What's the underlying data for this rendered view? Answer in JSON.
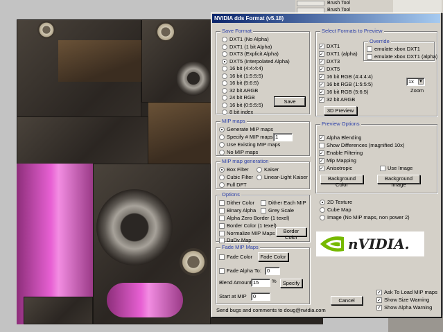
{
  "photoshop": {
    "layers": [
      "Brush Tool",
      "Brush Tool"
    ]
  },
  "dialog": {
    "title": "NVIDIA dds Format (v5.18)",
    "save_format": {
      "title": "Save Format",
      "options": [
        "DXT1 (No Alpha)",
        "DXT1 (1 bit Alpha)",
        "DXT3 (Explicit Alpha)",
        "DXT5 (Interpolated Alpha)",
        "4:4:4:4",
        "16 bit (1:5:5:5)",
        "16 bit (5:6:5)",
        "32 bit ARGB",
        "24 bit RGB",
        "16 bit (0:5:5:5)",
        "8 bit index"
      ],
      "selected": "DXT5 (Interpolated Alpha)",
      "save_label": "Save"
    },
    "select_formats": {
      "title": "Select Formats to Preview",
      "options": [
        "DXT1",
        "DXT1 (alpha)",
        "DXT3",
        "DXT5",
        "16 bit RGB (4:4:4:4)",
        "16 bit RGB (1:5:5:5)",
        "16 bit RGB (5:6:5)",
        "32 bit ARGB"
      ],
      "preview_label": "3D Preview"
    },
    "override": {
      "title": "Override",
      "options": [
        "emulate xbox DXT1",
        "emulate xbox DXT1 (alpha)"
      ]
    },
    "zoom": {
      "value": "1x",
      "label": "Zoom"
    },
    "mip_maps": {
      "title": "MIP maps",
      "options": [
        "Generate MIP maps",
        "Specify # MIP maps",
        "Use Existing MIP maps",
        "No MIP maps"
      ],
      "count": "1"
    },
    "mip_generation": {
      "title": "MIP map generation",
      "options": [
        "Box Filter",
        "Kaiser",
        "Cubic Filter",
        "Linear-Light Kaiser",
        "Full DFT"
      ]
    },
    "options": {
      "title": "Options",
      "items": [
        "Dither Color",
        "Dither Each MIP",
        "Binary Alpha",
        "Grey Scale",
        "Alpha Zero Border (1 texel)",
        "Border Color (1 texel)",
        "Normalize MIP Maps",
        "DuDv Map"
      ],
      "border_color_label": "Border Color"
    },
    "fade": {
      "title": "Fade MIP Maps",
      "fade_color": "Fade Color",
      "fade_color_btn": "Fade Color",
      "fade_alpha": "Fade Alpha To:",
      "fade_alpha_value": "0",
      "blend_amount": "Blend Amount",
      "blend_value": "15",
      "percent": "%",
      "specify": "Specify",
      "start_at": "Start at MIP",
      "start_value": "0"
    },
    "preview_options": {
      "title": "Preview Options",
      "items": [
        "Alpha Blending",
        "Show Differences (magnified 10x)",
        "Enable Filtering",
        "Mip Mapping",
        "Anisotropic"
      ],
      "use_image": "Use Image",
      "bg_color": "Background Color",
      "bg_image": "Background Image"
    },
    "texture_type": {
      "options": [
        "2D Texture",
        "Cube Map",
        "Image (No MIP maps, non power 2)"
      ]
    },
    "logo_text": "nVIDIA.",
    "ask_options": [
      "Ask To Load MIP maps",
      "Show Size Warning",
      "Show Alpha Warning"
    ],
    "cancel_label": "Cancel",
    "footer": "Send bugs and comments to doug@nvidia.com"
  }
}
